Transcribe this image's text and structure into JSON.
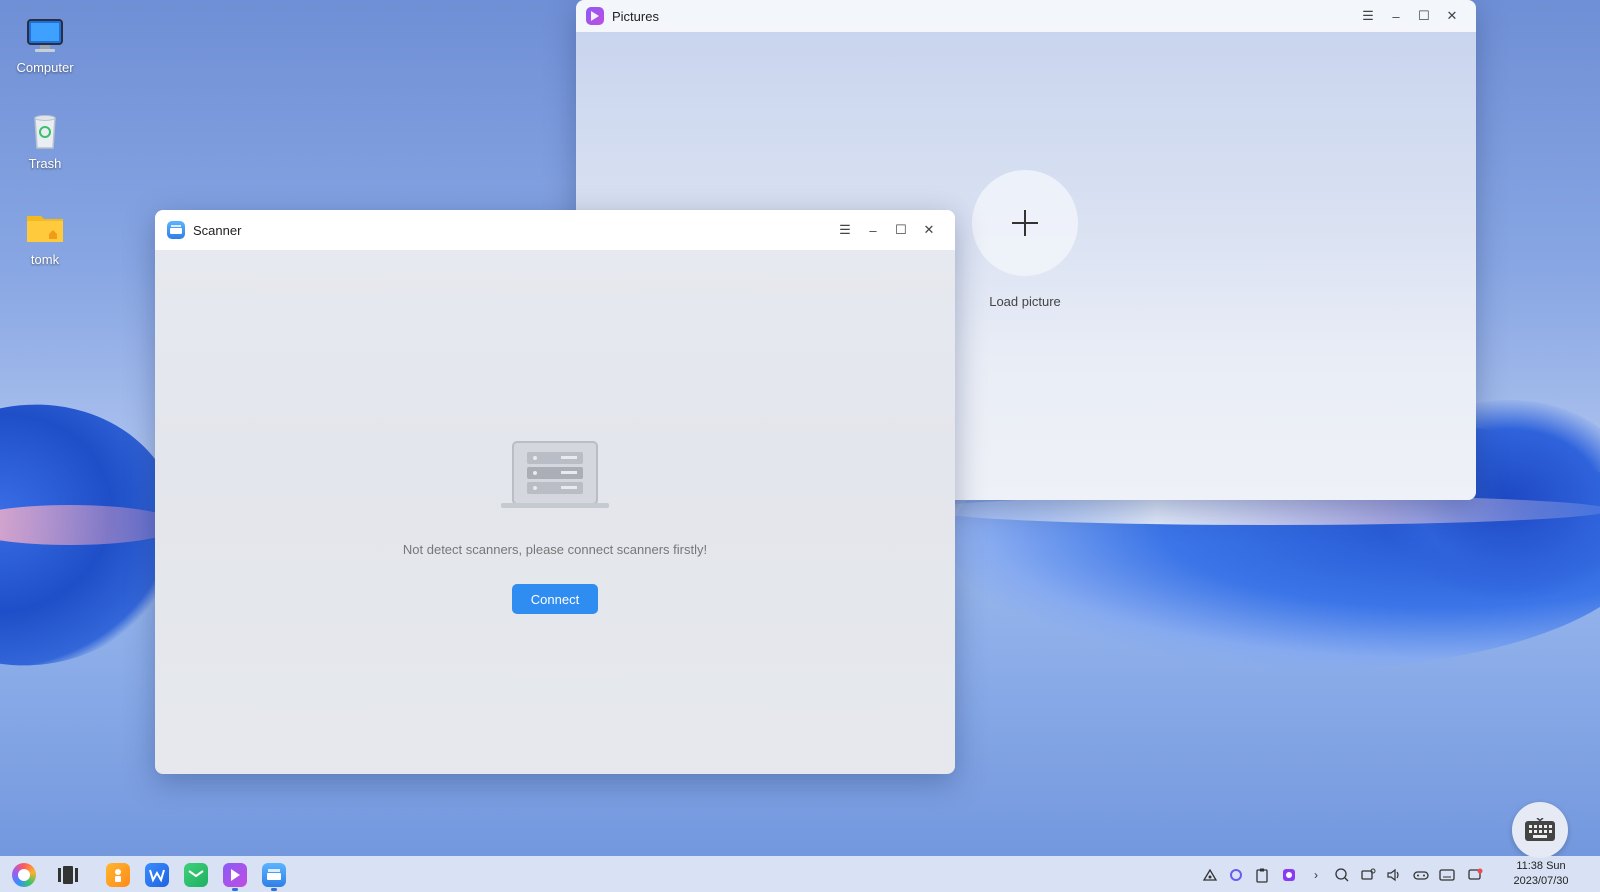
{
  "desktop": {
    "icons": [
      {
        "label": "Computer",
        "icon": "computer-icon"
      },
      {
        "label": "Trash",
        "icon": "trash-icon"
      },
      {
        "label": "tomk",
        "icon": "home-folder-icon"
      }
    ]
  },
  "pictures_window": {
    "title": "Pictures",
    "load_label": "Load picture",
    "controls": [
      "menu-icon",
      "minimize-icon",
      "maximize-icon",
      "close-icon"
    ]
  },
  "scanner_window": {
    "title": "Scanner",
    "message": "Not detect scanners, please connect scanners firstly!",
    "connect_label": "Connect",
    "controls": [
      "menu-icon",
      "minimize-icon",
      "maximize-icon",
      "close-icon"
    ]
  },
  "taskbar": {
    "apps": [
      "launcher-icon",
      "multitask-view-icon",
      "app-store-icon",
      "wps-icon",
      "mail-icon",
      "pictures-icon",
      "scanner-icon"
    ],
    "tray": [
      "network-icon",
      "assistant-icon",
      "clipboard-icon",
      "screen-recorder-icon",
      "expand-tray-icon",
      "search-icon",
      "display-icon",
      "volume-icon",
      "controller-icon",
      "keyboard-layout-icon",
      "notification-icon"
    ],
    "time": "11:38 Sun",
    "date": "2023/07/30"
  },
  "colors": {
    "accent": "#2f8cf0"
  }
}
